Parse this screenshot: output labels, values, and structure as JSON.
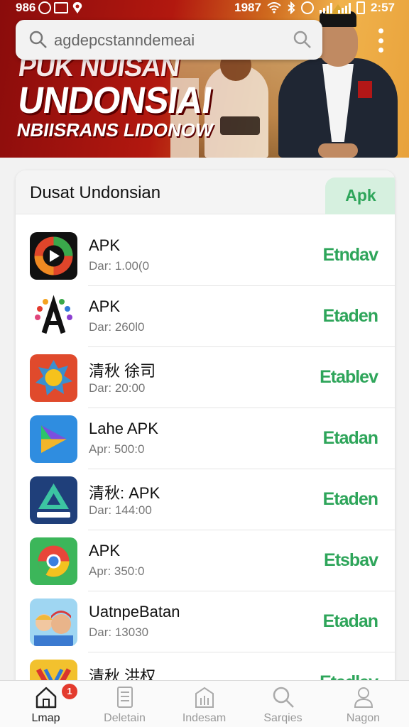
{
  "status_bar": {
    "left_text": "986",
    "signal_text": "1987",
    "time": "2:57"
  },
  "search": {
    "placeholder": "agdepcstanndemeai"
  },
  "banner": {
    "line1": "PUK NUISAN",
    "line2": "UNDONSIAI",
    "line3": "NBIISRANS LIDONOW"
  },
  "section": {
    "title": "Dusat Undonsian",
    "tab_label": "Apk"
  },
  "apps": [
    {
      "name": "APK",
      "meta": "Dar: 1.00(0",
      "action": "Etndav",
      "icon": "video-play-icon"
    },
    {
      "name": "APK",
      "meta": "Dar: 260l0",
      "action": "Etaden",
      "icon": "letter-a-burst-icon"
    },
    {
      "name": "清秋 徐司",
      "meta": "Dar: 20:00",
      "action": "Etablev",
      "icon": "sun-badge-icon"
    },
    {
      "name": "Lahe APK",
      "meta": "Apr: 500:0",
      "action": "Etadan",
      "icon": "play-triangle-icon"
    },
    {
      "name": "清秋: APK",
      "meta": "Dar: 144:00",
      "action": "Etaden",
      "icon": "mountain-a-icon"
    },
    {
      "name": "APK",
      "meta": "Apr: 350:0",
      "action": "Etsbav",
      "icon": "chrome-ring-icon"
    },
    {
      "name": "UatnpeBatan",
      "meta": "Dar: 13030",
      "action": "Etadan",
      "icon": "people-faces-icon"
    },
    {
      "name": "清秋 洪权",
      "meta": "",
      "action": "Etadlav",
      "icon": "v-shield-icon"
    }
  ],
  "bottom_nav": [
    {
      "label": "Lmap",
      "icon": "home-icon",
      "active": true,
      "badge": "1"
    },
    {
      "label": "Deletain",
      "icon": "document-icon",
      "active": false
    },
    {
      "label": "Indesam",
      "icon": "building-icon",
      "active": false
    },
    {
      "label": "Sarqies",
      "icon": "search-icon",
      "active": false
    },
    {
      "label": "Nagon",
      "icon": "profile-icon",
      "active": false
    }
  ],
  "colors": {
    "accent_green": "#2ea55a",
    "tab_bg": "#d6f0df",
    "badge_red": "#e33b2e"
  }
}
